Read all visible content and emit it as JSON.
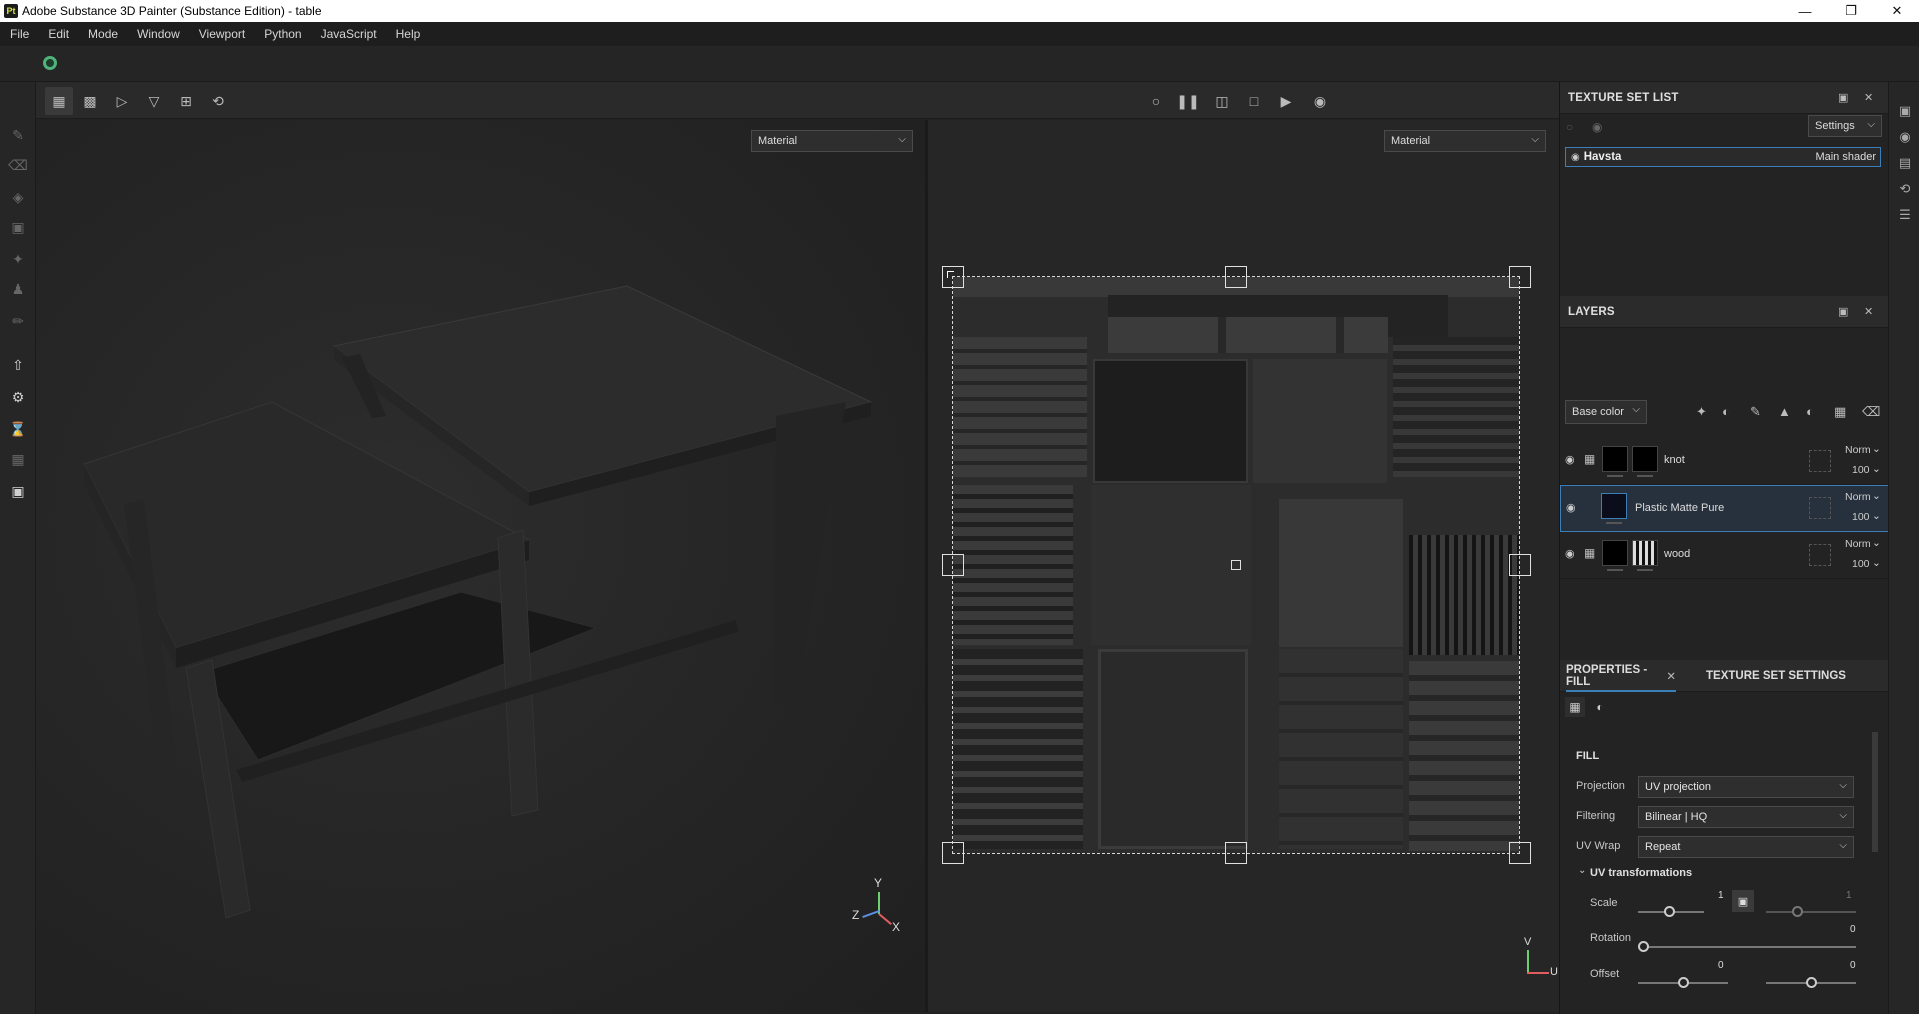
{
  "window": {
    "app_icon": "Pt",
    "title": "Adobe Substance 3D Painter (Substance Edition) - table",
    "minimize_icon": "minimize-icon",
    "maximize_icon": "restore-icon",
    "close_icon": "close-icon"
  },
  "menu": [
    "File",
    "Edit",
    "Mode",
    "Window",
    "Viewport",
    "Python",
    "JavaScript",
    "Help"
  ],
  "viewport_3d": {
    "channel_select": "Material",
    "axis_labels": {
      "y": "Y",
      "z": "Z",
      "x": "X"
    }
  },
  "viewport_2d": {
    "channel_select": "Material",
    "axis_labels": {
      "v": "V",
      "u": "U"
    }
  },
  "texture_set_list": {
    "title": "TEXTURE SET LIST",
    "settings_label": "Settings",
    "item_name": "Havsta",
    "item_shader": "Main shader"
  },
  "layers": {
    "title": "LAYERS",
    "channel_select": "Base color",
    "items": [
      {
        "name": "knot",
        "blend": "Norm",
        "opacity": "100",
        "type": "folder"
      },
      {
        "name": "Plastic Matte Pure",
        "blend": "Norm",
        "opacity": "100",
        "type": "fill"
      },
      {
        "name": "wood",
        "blend": "Norm",
        "opacity": "100",
        "type": "folder"
      }
    ]
  },
  "properties": {
    "tab_fill": "PROPERTIES - FILL",
    "tab_texture_set": "TEXTURE SET SETTINGS",
    "section_title": "FILL",
    "projection_label": "Projection",
    "projection_value": "UV projection",
    "filtering_label": "Filtering",
    "filtering_value": "Bilinear | HQ",
    "uvwrap_label": "UV Wrap",
    "uvwrap_value": "Repeat",
    "uv_transform_title": "UV transformations",
    "scale_label": "Scale",
    "scale_value": "1",
    "scale_value_locked": "1",
    "scale_fraction": 0.5,
    "rotation_label": "Rotation",
    "rotation_value": "0",
    "offset_label": "Offset",
    "offset_u_value": "0",
    "offset_v_value": "0"
  },
  "colors": {
    "accent": "#3c7fb8",
    "panel_bg": "#232323",
    "viewport_bg": "#262626"
  }
}
